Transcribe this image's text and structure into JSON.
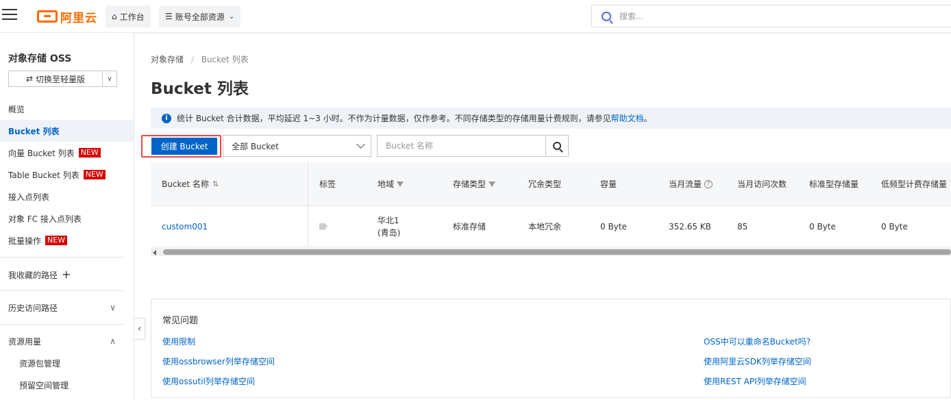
{
  "header": {
    "logo_text": "阿里云",
    "workbench_label": "工作台",
    "resources_label": "账号全部资源",
    "search_placeholder": "搜索..."
  },
  "sidebar": {
    "title": "对象存储 OSS",
    "switch_label": "切换至轻量版",
    "items": [
      {
        "label": "概览"
      },
      {
        "label": "Bucket 列表"
      },
      {
        "label": "向量 Bucket 列表",
        "badge": "NEW"
      },
      {
        "label": "Table Bucket 列表",
        "badge": "NEW"
      },
      {
        "label": "接入点列表"
      },
      {
        "label": "对象 FC 接入点列表"
      },
      {
        "label": "批量操作",
        "badge": "NEW"
      }
    ],
    "favorites_label": "我收藏的路径",
    "history_label": "历史访问路径",
    "resource_usage_label": "资源用量",
    "sub_items": [
      {
        "label": "资源包管理"
      },
      {
        "label": "预留空间管理"
      }
    ]
  },
  "breadcrumb": {
    "root": "对象存储",
    "current": "Bucket 列表"
  },
  "page_title": "Bucket 列表",
  "notice": {
    "text": "统计 Bucket 合计数据，平均延迟 1~3 小时。不作为计量数据，仅作参考。不同存储类型的存储用量计费规则，请参见",
    "link": "帮助文档",
    "suffix": "。"
  },
  "toolbar": {
    "create_label": "创建 Bucket",
    "filter_selected": "全部 Bucket",
    "name_search_placeholder": "Bucket 名称"
  },
  "table": {
    "headers": [
      "Bucket 名称",
      "标签",
      "地域",
      "存储类型",
      "冗余类型",
      "容量",
      "当月流量",
      "当月访问次数",
      "标准型存储量",
      "低频型计费存储量"
    ],
    "rows": [
      {
        "name": "custom001",
        "region_line1": "华北1",
        "region_line2": "(青岛)",
        "storage_type": "标准存储",
        "redundancy": "本地冗余",
        "capacity": "0 Byte",
        "traffic": "352.65 KB",
        "visits": "85",
        "standard_storage": "0 Byte",
        "ia_storage": "0 Byte"
      }
    ]
  },
  "faq": {
    "title": "常见问题",
    "left_links": [
      "使用限制",
      "使用ossbrowser列举存储空间",
      "使用ossutil列举存储空间"
    ],
    "right_links": [
      "OSS中可以重命名Bucket吗?",
      "使用阿里云SDK列举存储空间",
      "使用REST API列举存储空间"
    ]
  }
}
